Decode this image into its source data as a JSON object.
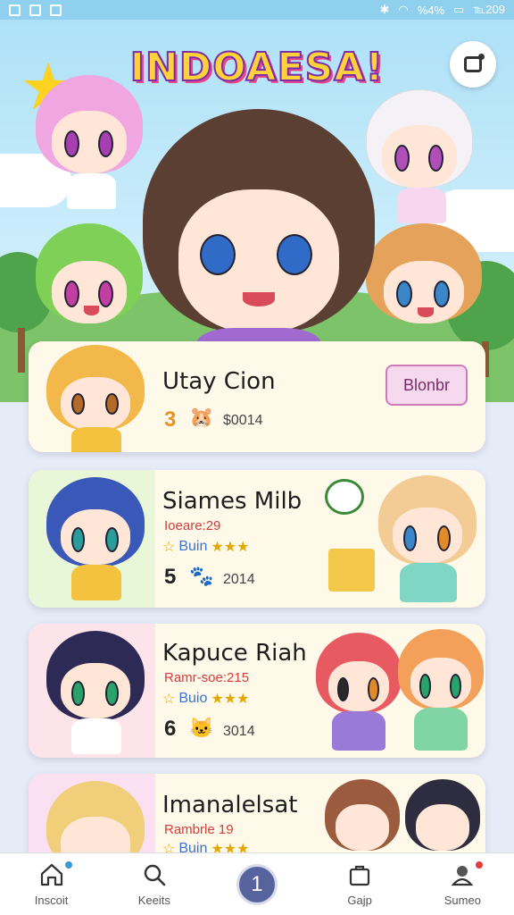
{
  "status_bar": {
    "right_text": "℡209",
    "signal": "%4%"
  },
  "hero": {
    "title": "INDOAESA!"
  },
  "cards": [
    {
      "name": "Utay Cion",
      "count": "3",
      "code": "$0014",
      "action_label": "Blonbr"
    },
    {
      "name": "Siames Milb",
      "subtitle": "Ioeare:29",
      "rating_label": "Buin",
      "count": "5",
      "code": "2014"
    },
    {
      "name": "Kapuce Riah",
      "subtitle": "Ramr-soe:215",
      "rating_label": "Buio",
      "count": "6",
      "code": "3014"
    },
    {
      "name": "Imanalelsat",
      "subtitle": "Rambrle 19",
      "rating_label": "Buin"
    }
  ],
  "nav": [
    {
      "label": "Inscoit",
      "icon": "home-icon"
    },
    {
      "label": "Keeits",
      "icon": "search-icon"
    },
    {
      "label": "1",
      "icon": "center-action"
    },
    {
      "label": "Gajp",
      "icon": "bag-icon"
    },
    {
      "label": "Sumeo",
      "icon": "profile-icon"
    }
  ],
  "colors": {
    "accent": "#56639c",
    "title_fill": "#ffd23a",
    "title_stroke": "#7a2ea8",
    "card_bg": "#fff9ea"
  }
}
